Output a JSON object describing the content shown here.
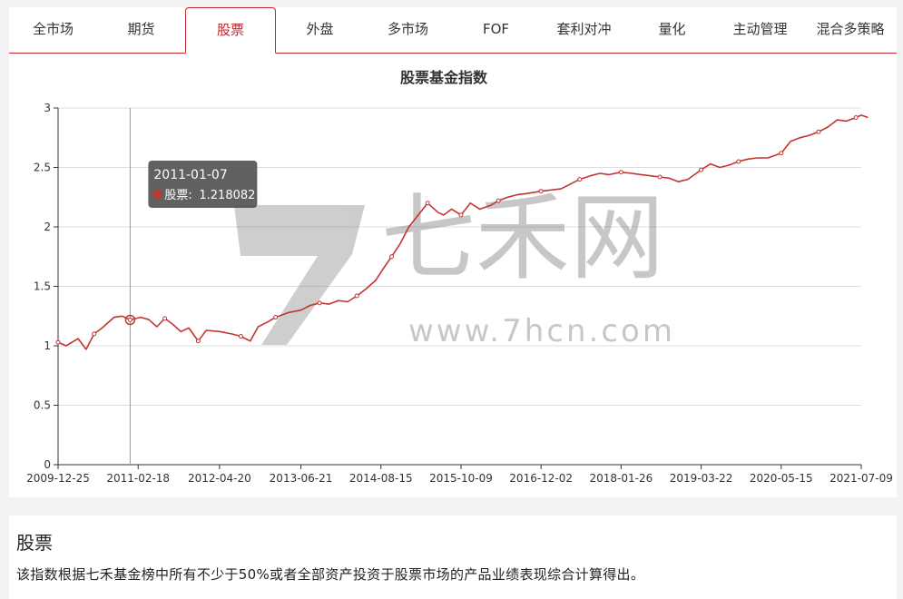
{
  "tabs": [
    {
      "label": "全市场",
      "active": false
    },
    {
      "label": "期货",
      "active": false
    },
    {
      "label": "股票",
      "active": true
    },
    {
      "label": "外盘",
      "active": false
    },
    {
      "label": "多市场",
      "active": false
    },
    {
      "label": "FOF",
      "active": false
    },
    {
      "label": "套利对冲",
      "active": false
    },
    {
      "label": "量化",
      "active": false
    },
    {
      "label": "主动管理",
      "active": false
    },
    {
      "label": "混合多策略",
      "active": false
    }
  ],
  "watermark": {
    "text": "七禾网",
    "url": "www.7hcn.com"
  },
  "tooltip": {
    "date": "2011-01-07",
    "series": "股票",
    "value": "1.218082"
  },
  "colors": {
    "accent": "#c0272d",
    "line": "#c23531",
    "tooltip_bg": "#505050"
  },
  "chart_data": {
    "type": "line",
    "title": "股票基金指数",
    "xlabel": "",
    "ylabel": "",
    "ylim": [
      0,
      3
    ],
    "y_ticks": [
      "0",
      "0.5",
      "1",
      "1.5",
      "2",
      "2.5",
      "3"
    ],
    "x_ticks": [
      "2009-12-25",
      "2011-02-18",
      "2012-04-20",
      "2013-06-21",
      "2014-08-15",
      "2015-10-09",
      "2016-12-02",
      "2018-01-26",
      "2019-03-22",
      "2020-05-15",
      "2021-07-09"
    ],
    "grid": true,
    "legend": "none",
    "series": [
      {
        "name": "股票",
        "x": [
          "2009-12-25",
          "2010-02-05",
          "2010-04-09",
          "2010-05-21",
          "2010-07-02",
          "2010-08-13",
          "2010-10-15",
          "2010-11-26",
          "2011-01-07",
          "2011-03-04",
          "2011-04-15",
          "2011-05-27",
          "2011-07-08",
          "2011-08-19",
          "2011-09-30",
          "2011-11-11",
          "2011-12-30",
          "2012-02-10",
          "2012-04-20",
          "2012-06-22",
          "2012-08-10",
          "2012-09-28",
          "2012-11-09",
          "2012-12-28",
          "2013-02-08",
          "2013-04-19",
          "2013-06-21",
          "2013-08-09",
          "2013-09-27",
          "2013-11-15",
          "2014-01-03",
          "2014-02-21",
          "2014-04-11",
          "2014-05-30",
          "2014-07-18",
          "2014-08-15",
          "2014-10-10",
          "2014-11-21",
          "2015-01-09",
          "2015-02-27",
          "2015-04-17",
          "2015-06-12",
          "2015-07-10",
          "2015-08-21",
          "2015-10-09",
          "2015-11-27",
          "2016-01-15",
          "2016-03-11",
          "2016-04-22",
          "2016-06-10",
          "2016-07-29",
          "2016-09-16",
          "2016-12-02",
          "2017-01-20",
          "2017-03-17",
          "2017-05-05",
          "2017-06-23",
          "2017-08-18",
          "2017-10-06",
          "2017-11-24",
          "2018-01-26",
          "2018-03-23",
          "2018-05-11",
          "2018-06-29",
          "2018-08-17",
          "2018-10-05",
          "2018-11-23",
          "2019-01-11",
          "2019-03-22",
          "2019-05-10",
          "2019-06-28",
          "2019-08-16",
          "2019-10-04",
          "2019-11-22",
          "2020-01-10",
          "2020-03-06",
          "2020-05-15",
          "2020-07-03",
          "2020-08-21",
          "2020-10-09",
          "2020-11-27",
          "2021-01-15",
          "2021-03-05",
          "2021-04-23",
          "2021-06-11",
          "2021-07-09",
          "2021-08-13"
        ],
        "values": [
          1.03,
          1.0,
          1.06,
          0.97,
          1.1,
          1.15,
          1.24,
          1.25,
          1.218,
          1.24,
          1.22,
          1.16,
          1.23,
          1.18,
          1.12,
          1.15,
          1.04,
          1.13,
          1.12,
          1.1,
          1.08,
          1.04,
          1.16,
          1.2,
          1.24,
          1.28,
          1.3,
          1.34,
          1.36,
          1.35,
          1.38,
          1.37,
          1.42,
          1.48,
          1.55,
          1.62,
          1.75,
          1.85,
          2.0,
          2.1,
          2.2,
          2.12,
          2.1,
          2.15,
          2.1,
          2.2,
          2.15,
          2.18,
          2.22,
          2.25,
          2.27,
          2.28,
          2.3,
          2.31,
          2.32,
          2.36,
          2.4,
          2.43,
          2.45,
          2.44,
          2.46,
          2.45,
          2.44,
          2.43,
          2.42,
          2.41,
          2.38,
          2.4,
          2.48,
          2.53,
          2.5,
          2.52,
          2.55,
          2.57,
          2.58,
          2.58,
          2.62,
          2.72,
          2.75,
          2.77,
          2.8,
          2.84,
          2.9,
          2.89,
          2.92,
          2.94,
          2.92
        ]
      }
    ]
  },
  "description": {
    "title": "股票",
    "text": "该指数根据七禾基金榜中所有不少于50%或者全部资产投资于股票市场的产品业绩表现综合计算得出。"
  }
}
